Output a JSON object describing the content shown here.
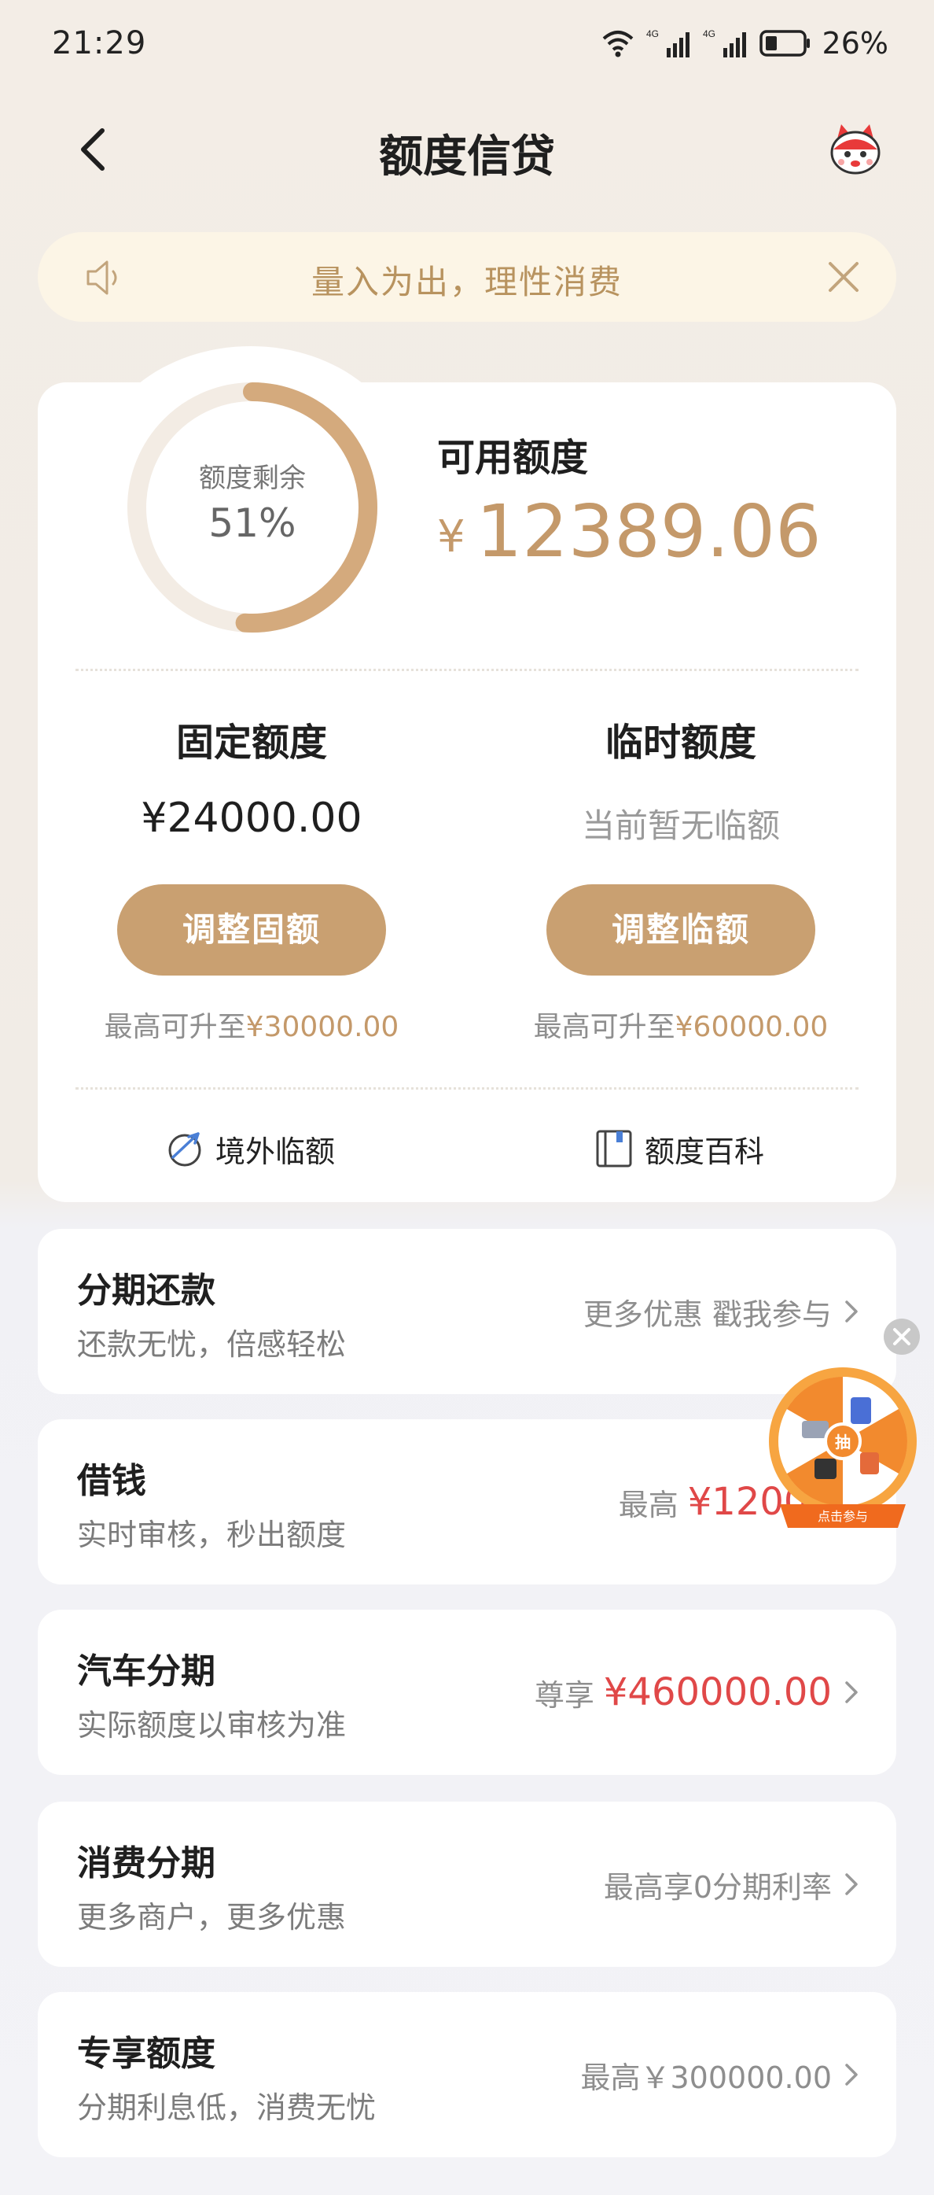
{
  "status_bar": {
    "time": "21:29",
    "network_1": "4G",
    "network_2": "4G",
    "battery": "26%"
  },
  "header": {
    "title": "额度信贷",
    "back_icon": "chevron-left-icon",
    "mascot_icon": "mascot-icon"
  },
  "notice": {
    "text": "量入为出，理性消费",
    "speaker_icon": "speaker-icon",
    "close_icon": "close-icon"
  },
  "credit": {
    "remaining_label": "额度剩余",
    "remaining_percent": "51%",
    "remaining_fraction": 0.51,
    "available_label": "可用额度",
    "currency": "¥",
    "available_amount": "12389.06",
    "fixed": {
      "title": "固定额度",
      "value": "¥24000.00",
      "button": "调整固额",
      "note_prefix": "最高可升至",
      "note_amount": "¥30000.00"
    },
    "temporary": {
      "title": "临时额度",
      "value": "当前暂无临额",
      "button": "调整临额",
      "note_prefix": "最高可升至",
      "note_amount": "¥60000.00"
    },
    "links": [
      {
        "label": "境外临额",
        "icon": "plane-icon"
      },
      {
        "label": "额度百科",
        "icon": "book-icon"
      }
    ]
  },
  "services": [
    {
      "title": "分期还款",
      "subtitle": "还款无忧，倍感轻松",
      "right_text": "更多优惠 戳我参与"
    },
    {
      "title": "借钱",
      "subtitle": "实时审核，秒出额度",
      "right_prefix": "最高",
      "right_amount": "¥12000"
    },
    {
      "title": "汽车分期",
      "subtitle": "实际额度以审核为准",
      "right_prefix": "尊享",
      "right_amount": "¥460000.00"
    },
    {
      "title": "消费分期",
      "subtitle": "更多商户，更多优惠",
      "right_text": "最高享0分期利率"
    },
    {
      "title": "专享额度",
      "subtitle": "分期利息低，消费无忧",
      "right_text": "最高￥300000.00"
    }
  ],
  "floating_widget": {
    "center_label": "抽",
    "caption": "点击参与",
    "icon": "lottery-wheel-icon"
  },
  "colors": {
    "accent": "#c9a071",
    "accent_text": "#c4996a",
    "highlight_red": "#e04848",
    "notice_bg": "#fcf5e6"
  }
}
